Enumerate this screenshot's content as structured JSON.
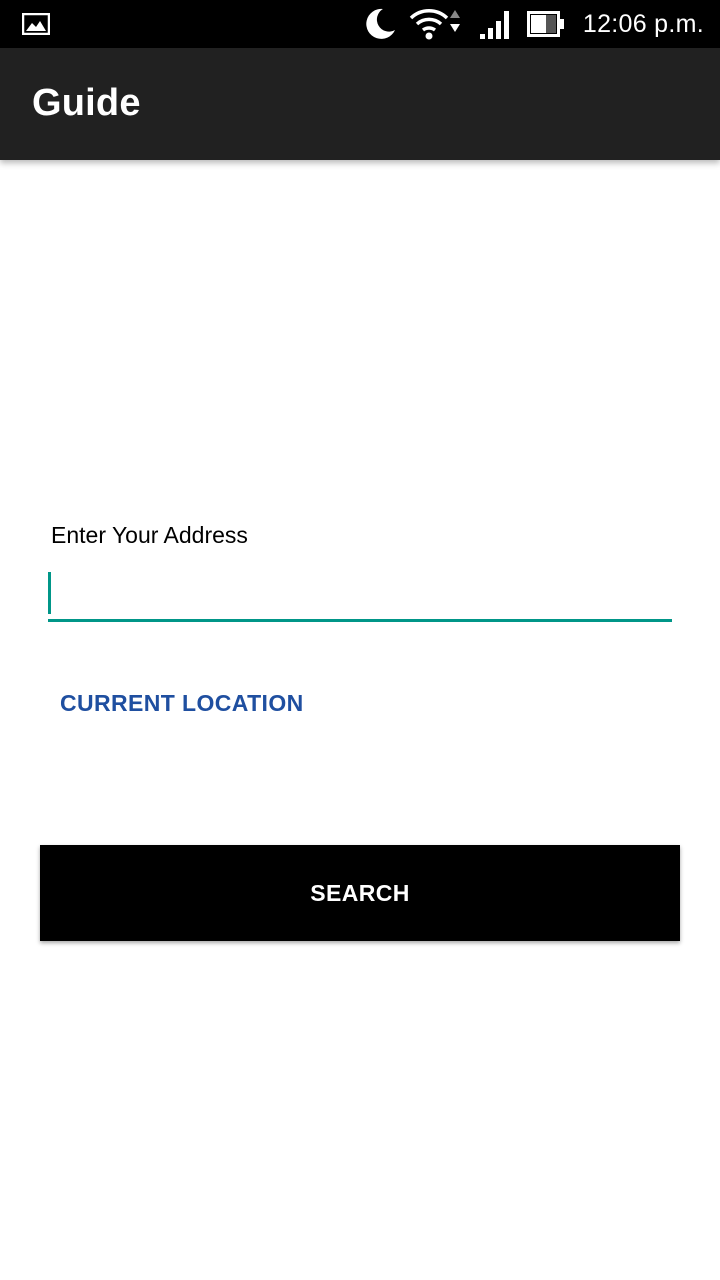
{
  "status_bar": {
    "time": "12:06 p.m.",
    "icons": [
      "gallery-icon",
      "moon-icon",
      "wifi-icon",
      "signal-icon",
      "battery-icon"
    ]
  },
  "app_bar": {
    "title": "Guide",
    "background_color": "#212121"
  },
  "form": {
    "address_label": "Enter Your Address",
    "address_value": "",
    "accent_color": "#009688",
    "current_location_label": "CURRENT LOCATION",
    "current_location_color": "#1f4fa0",
    "search_label": "SEARCH"
  }
}
